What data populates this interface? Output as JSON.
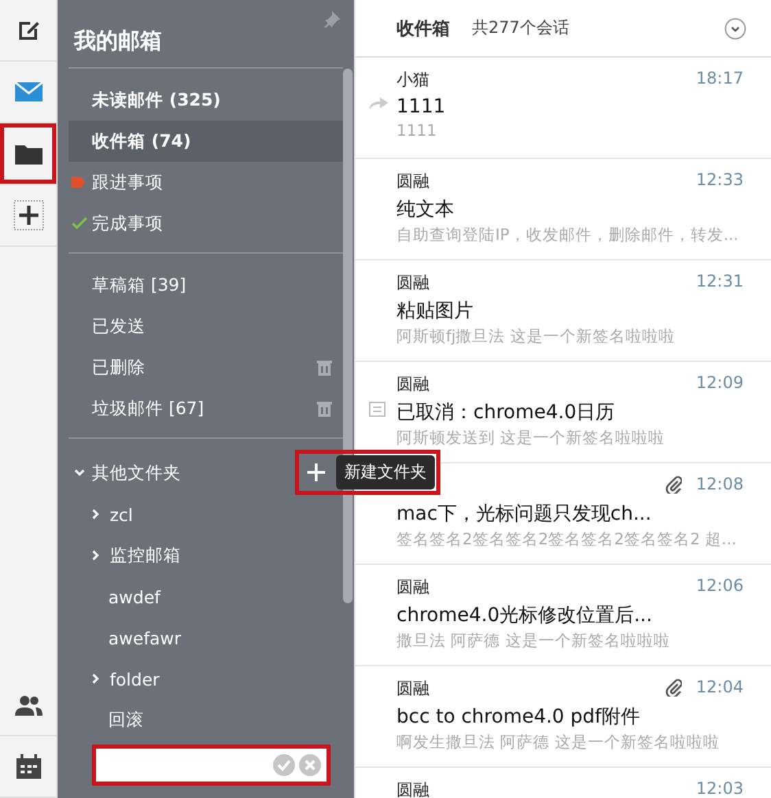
{
  "rail": {
    "top": [
      {
        "kind": "compose",
        "annotated": false
      },
      {
        "kind": "mail",
        "annotated": false
      },
      {
        "kind": "folder",
        "annotated": true
      },
      {
        "kind": "add",
        "annotated": false
      }
    ],
    "bottom": [
      {
        "kind": "contacts"
      },
      {
        "kind": "calendar"
      }
    ]
  },
  "sidebar": {
    "title": "我的邮箱",
    "groups": [
      [
        {
          "label": "未读邮件 (325)",
          "kind": "bold",
          "selected": false
        },
        {
          "label": "收件箱 (74)",
          "kind": "bold",
          "selected": true
        },
        {
          "label": "跟进事项",
          "kind": "flag",
          "selected": false
        },
        {
          "label": "完成事项",
          "kind": "done",
          "selected": false
        }
      ],
      [
        {
          "label": "草稿箱 [39]",
          "kind": "plain",
          "selected": false
        },
        {
          "label": "已发送",
          "kind": "plain",
          "selected": false
        },
        {
          "label": "已删除",
          "kind": "trash",
          "selected": false
        },
        {
          "label": "垃圾邮件 [67]",
          "kind": "trash",
          "selected": false
        }
      ]
    ],
    "other_folders": {
      "label": "其他文件夹",
      "expanded": true,
      "add_tooltip": "新建文件夹",
      "annotated": true,
      "children": [
        {
          "label": "zcl",
          "collapsed": true
        },
        {
          "label": "监控邮箱",
          "collapsed": true
        },
        {
          "label": "awdef",
          "collapsed": false
        },
        {
          "label": "awefawr",
          "collapsed": false
        },
        {
          "label": "folder",
          "collapsed": true
        },
        {
          "label": "回滚",
          "collapsed": false
        }
      ]
    },
    "new_folder_field": {
      "annotated": true
    }
  },
  "mail_list": {
    "title": "收件箱",
    "count": "共277个会话",
    "rows": [
      {
        "sender": "小猫",
        "subject": "1111",
        "preview": "1111",
        "time": "18:17",
        "kind": "forward",
        "attachment": false
      },
      {
        "sender": "圆融",
        "subject": "纯文本",
        "preview": "自助查询登陆IP，收发邮件，删除邮件，转发...",
        "time": "12:33",
        "kind": "plain",
        "attachment": false
      },
      {
        "sender": "圆融",
        "subject": "粘贴图片",
        "preview": "阿斯顿fj撒旦法 这是一个新签名啦啦啦",
        "time": "12:31",
        "kind": "plain",
        "attachment": false
      },
      {
        "sender": "圆融",
        "subject": "已取消：chrome4.0日历",
        "preview": "阿斯顿发送到 这是一个新签名啦啦啦",
        "time": "12:09",
        "kind": "calendar",
        "attachment": false
      },
      {
        "subject": "mac下，光标问题只发现ch...",
        "preview": "签名签名2签名签名2签名签名2签名签名2 超...",
        "time": "12:08",
        "kind": "plain",
        "attachment": true
      },
      {
        "sender": "圆融",
        "subject": "chrome4.0光标修改位置后...",
        "preview": "撒旦法 阿萨德 这是一个新签名啦啦啦",
        "time": "12:06",
        "kind": "plain",
        "attachment": false
      },
      {
        "sender": "圆融",
        "subject": "bcc to chrome4.0 pdf附件",
        "preview": "啊发生撒旦法 阿萨德 这是一个新签名啦啦啦",
        "time": "12:04",
        "kind": "plain",
        "attachment": true
      },
      {
        "sender": "圆融",
        "time": "12:03",
        "kind": "plain",
        "attachment": false
      }
    ]
  }
}
